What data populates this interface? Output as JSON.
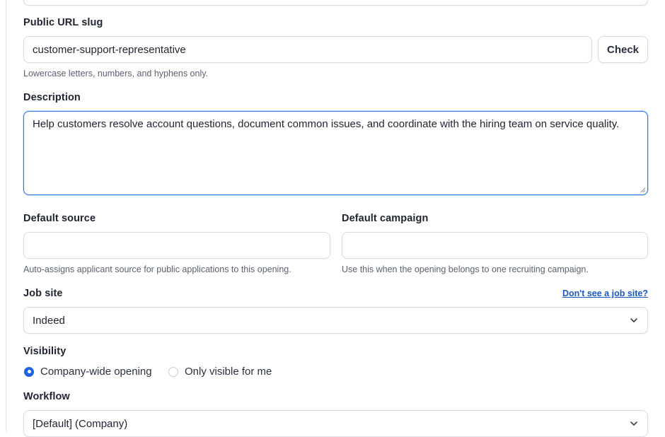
{
  "slug": {
    "label": "Public URL slug",
    "value": "customer-support-representative",
    "check_label": "Check",
    "help": "Lowercase letters, numbers, and hyphens only."
  },
  "description": {
    "label": "Description",
    "value": "Help customers resolve account questions, document common issues, and coordinate with the hiring team on service quality."
  },
  "default_source": {
    "label": "Default source",
    "value": "",
    "help": "Auto-assigns applicant source for public applications to this opening."
  },
  "default_campaign": {
    "label": "Default campaign",
    "value": "",
    "help": "Use this when the opening belongs to one recruiting campaign."
  },
  "job_site": {
    "label": "Job site",
    "link": "Don't see a job site?",
    "selected": "Indeed"
  },
  "visibility": {
    "label": "Visibility",
    "options": [
      {
        "label": "Company-wide opening",
        "selected": true
      },
      {
        "label": "Only visible for me",
        "selected": false
      }
    ]
  },
  "workflow": {
    "label": "Workflow",
    "selected": "[Default] (Company)"
  },
  "colors": {
    "accent": "#1f63e0",
    "focus_border": "#2f7ae5",
    "link": "#1a56c6"
  },
  "icons": {
    "select_chevron": "chevron-down-icon",
    "resize_handle": "resize-handle-icon"
  }
}
